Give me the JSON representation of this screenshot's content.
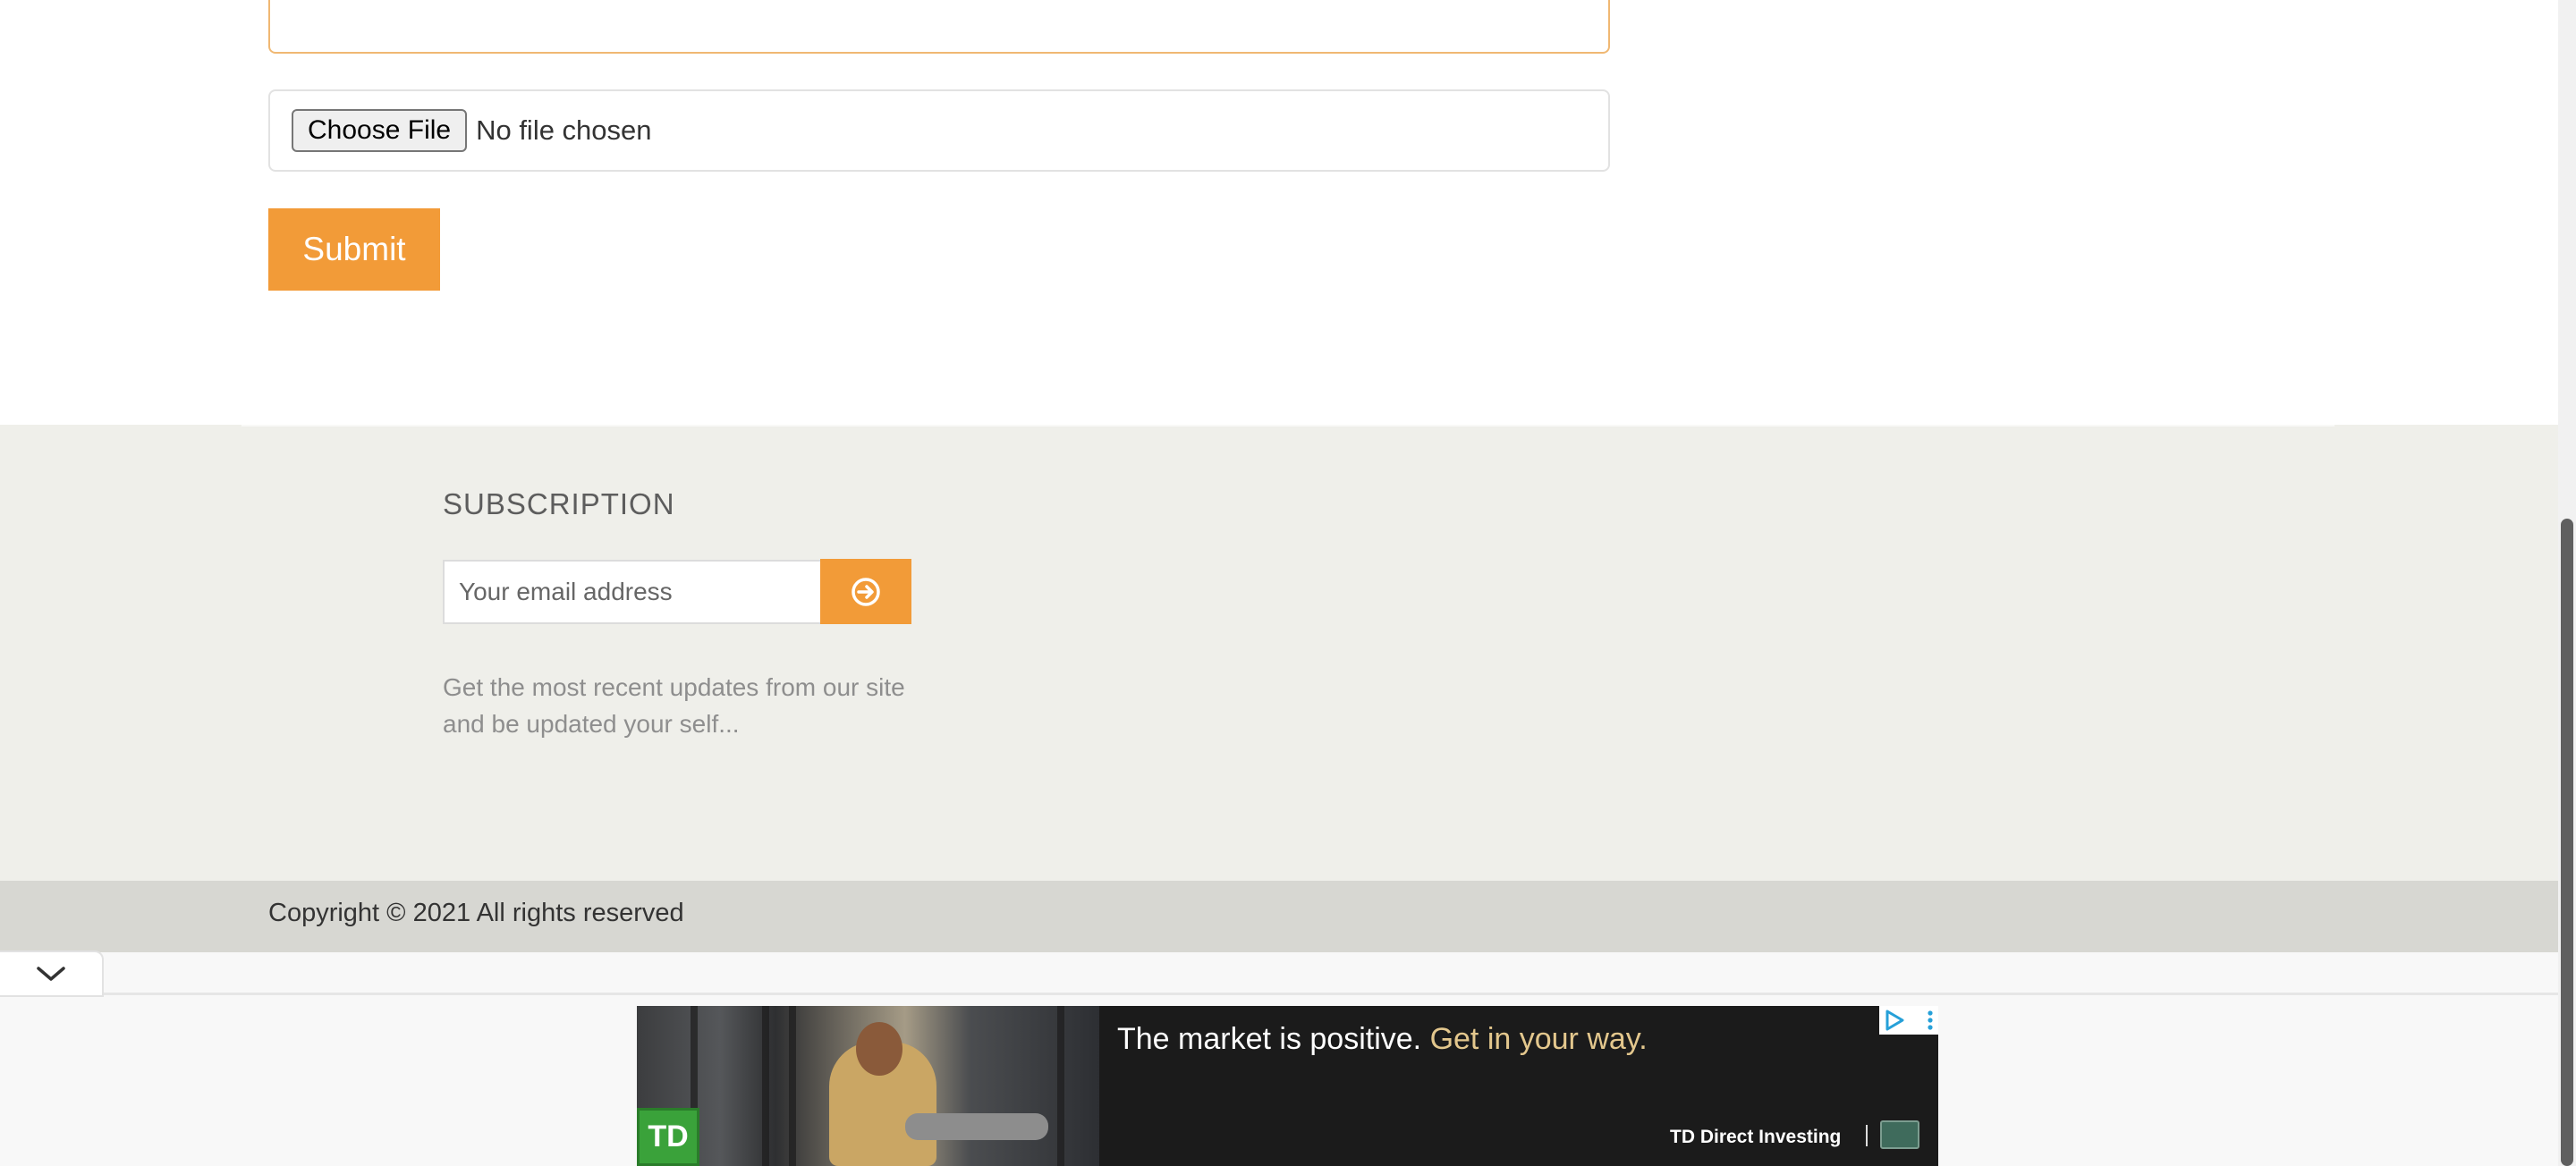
{
  "form": {
    "file_button_label": "Choose File",
    "file_status": "No file chosen",
    "submit_label": "Submit"
  },
  "subscription": {
    "title": "SUBSCRIPTION",
    "email_placeholder": "Your email address",
    "button_icon": "arrow-circle-right-icon",
    "description": "Get the most recent updates from our site and be updated your self..."
  },
  "footer": {
    "copyright": "Copyright © 2021 All rights reserved"
  },
  "ad": {
    "headline": "The market is positive.",
    "headline_accent": "Get in your way.",
    "brand": "TD Direct Investing",
    "logo_text": "TD"
  },
  "colors": {
    "accent": "#f29b38",
    "footer_bg": "#efefea",
    "copyright_bg": "#d7d7d2",
    "ad_bg": "#1b1b1b",
    "ad_accent": "#e3c78d",
    "td_green": "#3aa23a"
  }
}
